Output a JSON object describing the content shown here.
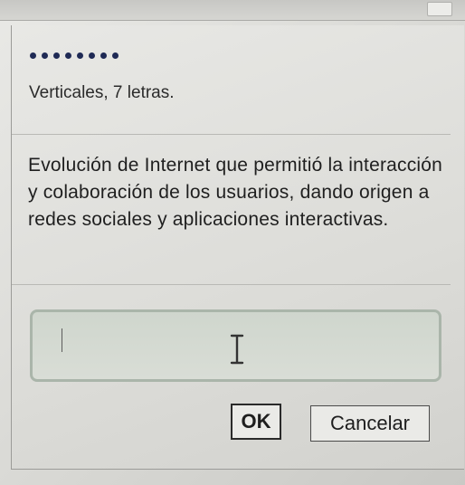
{
  "puzzle": {
    "dot_count": 8,
    "hint": "Verticales, 7 letras.",
    "clue": "Evolución de Internet que permitió la interacción y colaboración de los usuarios, dando origen a redes sociales y aplicaciones interactivas."
  },
  "answer": {
    "value": ""
  },
  "buttons": {
    "ok": "OK",
    "cancel": "Cancelar"
  },
  "icons": {
    "cursor": "text-cursor-icon"
  }
}
